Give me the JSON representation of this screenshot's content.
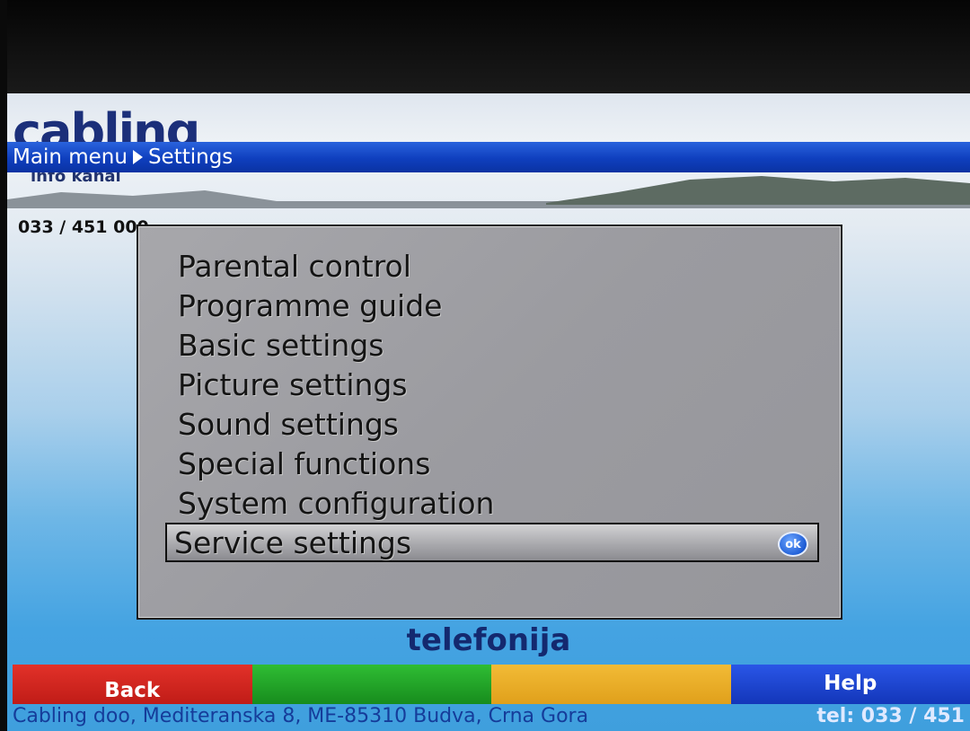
{
  "brand": {
    "logo_text": "cabling",
    "channel_text": "info kanal"
  },
  "breadcrumb": {
    "root": "Main menu",
    "current": "Settings"
  },
  "phone": "033 / 451 000",
  "menu": {
    "items": [
      {
        "label": "Parental control",
        "selected": false
      },
      {
        "label": "Programme guide",
        "selected": false
      },
      {
        "label": "Basic settings",
        "selected": false
      },
      {
        "label": "Picture settings",
        "selected": false
      },
      {
        "label": "Sound settings",
        "selected": false
      },
      {
        "label": "Special functions",
        "selected": false
      },
      {
        "label": "System configuration",
        "selected": false
      },
      {
        "label": "Service settings",
        "selected": true
      }
    ],
    "ok_badge": "ok"
  },
  "promo_text": "telefonija",
  "footer": {
    "red": "Back",
    "green": "",
    "yellow": "",
    "blue": "Help"
  },
  "address": {
    "text": "Cabling doo, Mediteranska 8, ME-85310 Budva, Crna Gora",
    "tel": "tel: 033 / 451"
  },
  "colors": {
    "breadcrumb_bar": "#0f3fbe",
    "panel_bg": "#9d9da2",
    "key_red": "#d0241e",
    "key_green": "#1fa325",
    "key_yellow": "#eaac27",
    "key_blue": "#1a42cc"
  }
}
